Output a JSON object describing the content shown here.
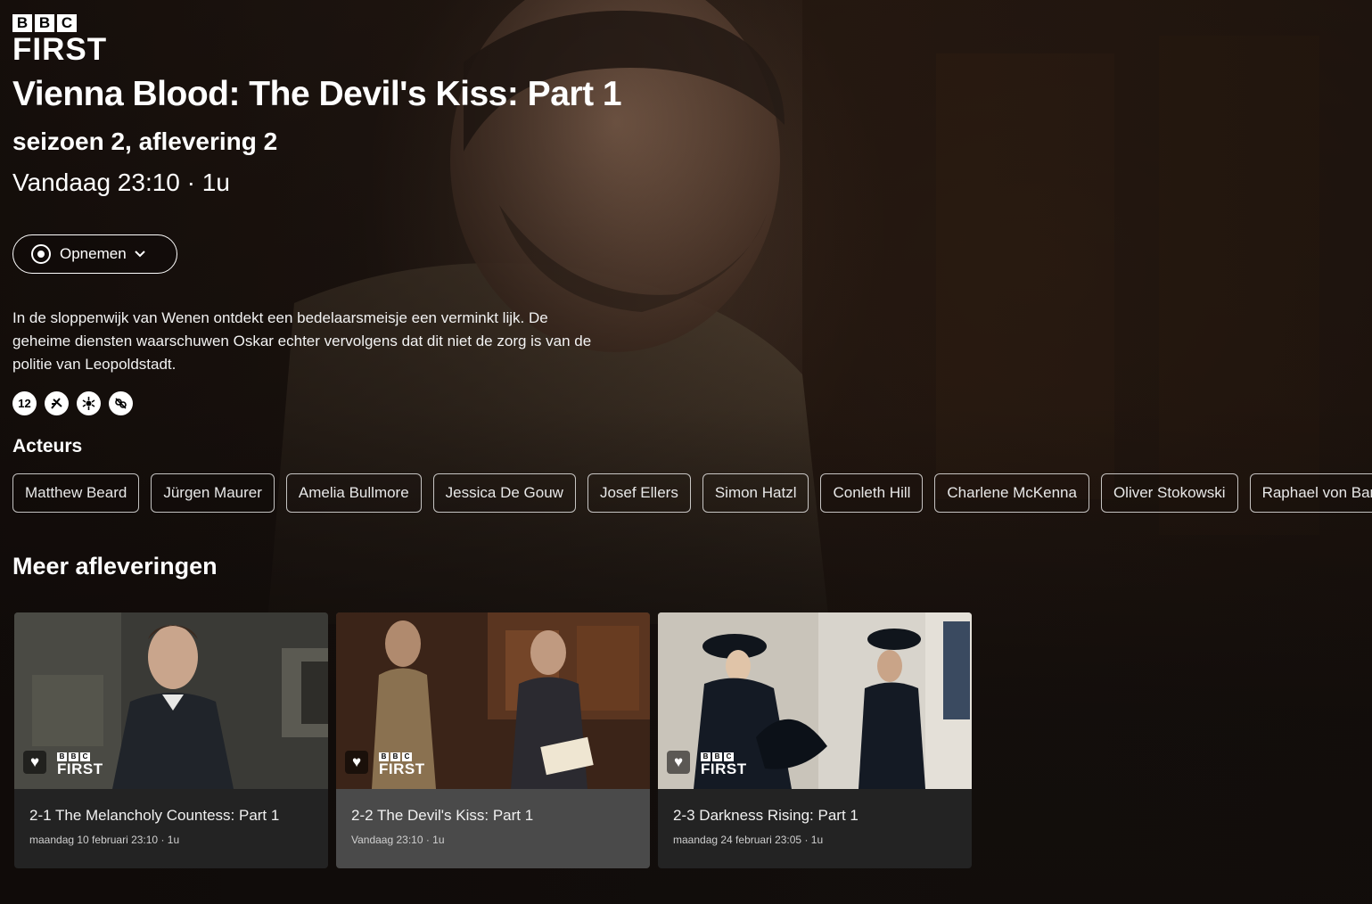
{
  "brand": {
    "bbc_letters": [
      "B",
      "B",
      "C"
    ],
    "channel": "FIRST"
  },
  "program": {
    "title": "Vienna Blood: The Devil's Kiss: Part 1",
    "subtitle": "seizoen 2, aflevering 2",
    "airtime": "Vandaag 23:10 · 1u",
    "description": "In de sloppenwijk van Wenen ontdekt een bedelaarsmeisje een verminkt lijk. De geheime diensten waarschuwen Oskar echter vervolgens dat dit niet de zorg is van de politie van Leopoldstadt."
  },
  "actions": {
    "record_label": "Opnemen",
    "record_icon": "record-icon",
    "dropdown_icon": "chevron-down-icon"
  },
  "ratings": [
    {
      "label": "12",
      "icon": "age-12-icon"
    },
    {
      "label": "",
      "icon": "violence-icon"
    },
    {
      "label": "",
      "icon": "fear-icon"
    },
    {
      "label": "",
      "icon": "discrimination-icon"
    }
  ],
  "actors_heading": "Acteurs",
  "actors": [
    "Matthew Beard",
    "Jürgen Maurer",
    "Amelia Bullmore",
    "Jessica De Gouw",
    "Josef Ellers",
    "Simon Hatzl",
    "Conleth Hill",
    "Charlene McKenna",
    "Oliver Stokowski",
    "Raphael von Bargen"
  ],
  "more_heading": "Meer afleveringen",
  "episodes": [
    {
      "title": "2-1 The Melancholy Countess: Part 1",
      "meta": "maandag 10 februari 23:10 · 1u",
      "active": false
    },
    {
      "title": "2-2 The Devil's Kiss: Part 1",
      "meta": "Vandaag 23:10 · 1u",
      "active": true
    },
    {
      "title": "2-3 Darkness Rising: Part 1",
      "meta": "maandag 24 februari 23:05 · 1u",
      "active": false
    }
  ],
  "colors": {
    "background": "#1c1410",
    "card": "#232323",
    "card_active": "#4a4a4a",
    "text": "#ffffff"
  }
}
